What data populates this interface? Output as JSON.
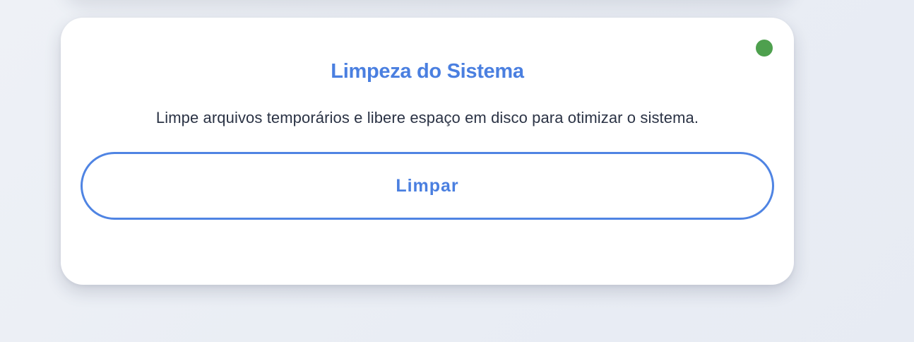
{
  "card": {
    "title": "Limpeza do Sistema",
    "description": "Limpe arquivos temporários e libere espaço em disco para otimizar o sistema.",
    "button_label": "Limpar",
    "status_color": "#4ea04e",
    "accent_color": "#4a7fe0"
  }
}
